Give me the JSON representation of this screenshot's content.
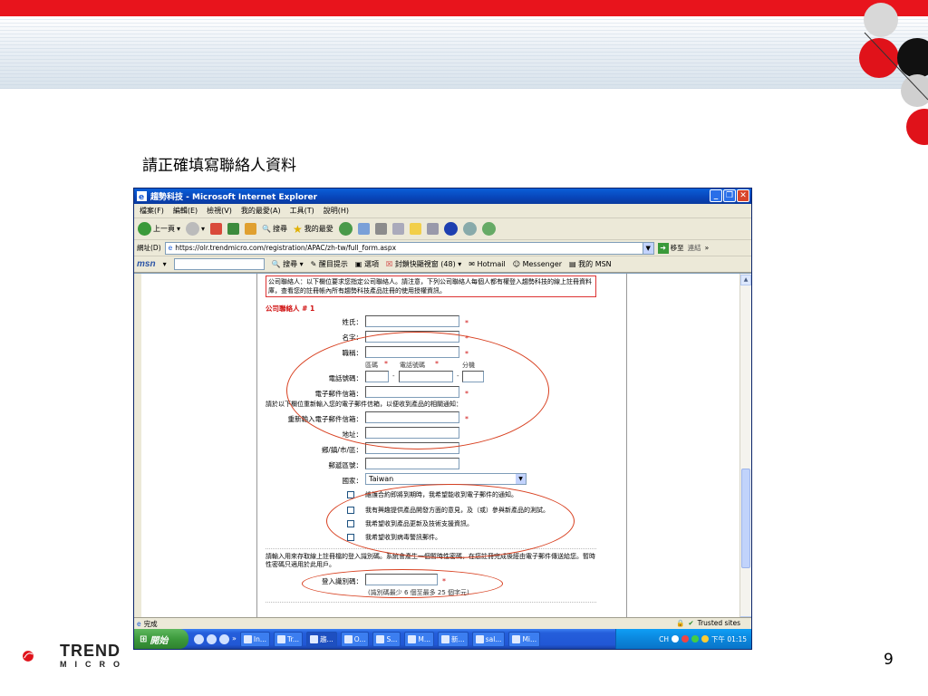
{
  "slide": {
    "title": "請正確填寫聯絡人資料",
    "page_number": "9",
    "logo_text": "TREND",
    "logo_sub": "MICRO"
  },
  "browser": {
    "window_title": "趨勢科技 - Microsoft Internet Explorer",
    "menu": [
      "檔案(F)",
      "編輯(E)",
      "檢視(V)",
      "我的最愛(A)",
      "工具(T)",
      "說明(H)"
    ],
    "toolbar": {
      "back": "上一頁",
      "search": "搜尋",
      "favorites": "我的最愛"
    },
    "address_label": "網址(D)",
    "address_url": "https://olr.trendmicro.com/registration/APAC/zh-tw/full_form.aspx",
    "go_label": "移至",
    "links_label": "連結",
    "msn": {
      "logo": "msn",
      "search": "搜尋",
      "highlight": "醒目提示",
      "options": "選項",
      "popup_blocker": "封鎖快顯視窗 (48)",
      "hotmail": "Hotmail",
      "messenger": "Messenger",
      "my_msn": "我的 MSN"
    },
    "status_text": "完成",
    "status_zone": "Trusted sites"
  },
  "form": {
    "notice": "公司聯絡人：以下欄位要求您指定公司聯絡人。請注意，下列公司聯絡人每個人都有權登入趨勢科技的線上註冊資料庫，查看您的註冊帳內所有趨勢科技產品註冊的使用授權資訊。",
    "contact_header": "公司聯絡人 # 1",
    "fields": {
      "last_name": "姓氏：",
      "first_name": "名字：",
      "title": "職稱：",
      "phone": "電話號碼：",
      "phone_area": "區碼",
      "phone_number": "電話號碼",
      "phone_ext": "分機",
      "email": "電子郵件信箱：",
      "email_note": "請於以下欄位重新輸入您的電子郵件信箱，以便收到產品的相關通知：",
      "email_confirm": "重新輸入電子郵件信箱：",
      "address": "地址：",
      "city": "鄉/鎮/市/區：",
      "postal": "郵遞區號：",
      "country": "國家：",
      "country_value": "Taiwan"
    },
    "required_mark": "*",
    "checkboxes": [
      "維護合約即將到期時，我希望能收到電子郵件的通知。",
      "我有興趣提供產品開發方面的意見，及（或）參與新產品的測試。",
      "我希望收到產品更新及技術支援資訊。",
      "我希望收到病毒警訊郵件。"
    ],
    "login_note": "請輸入用來存取線上註冊檔的登入識別碼。系統會產生一個暫時性密碼，在您註冊完成後經由電子郵件傳送給您。暫時性密碼只適用於此用戶。",
    "login_label": "登入識別碼：",
    "login_hint": "(識別碼最少 6 個至最多 25 個字元)"
  },
  "taskbar": {
    "start": "開始",
    "tasks": [
      "In...",
      "Tr...",
      "趨...",
      "O...",
      "S...",
      "M...",
      "新...",
      "sal...",
      "Mi..."
    ],
    "lang": "CH",
    "clock": "下午 01:15"
  }
}
